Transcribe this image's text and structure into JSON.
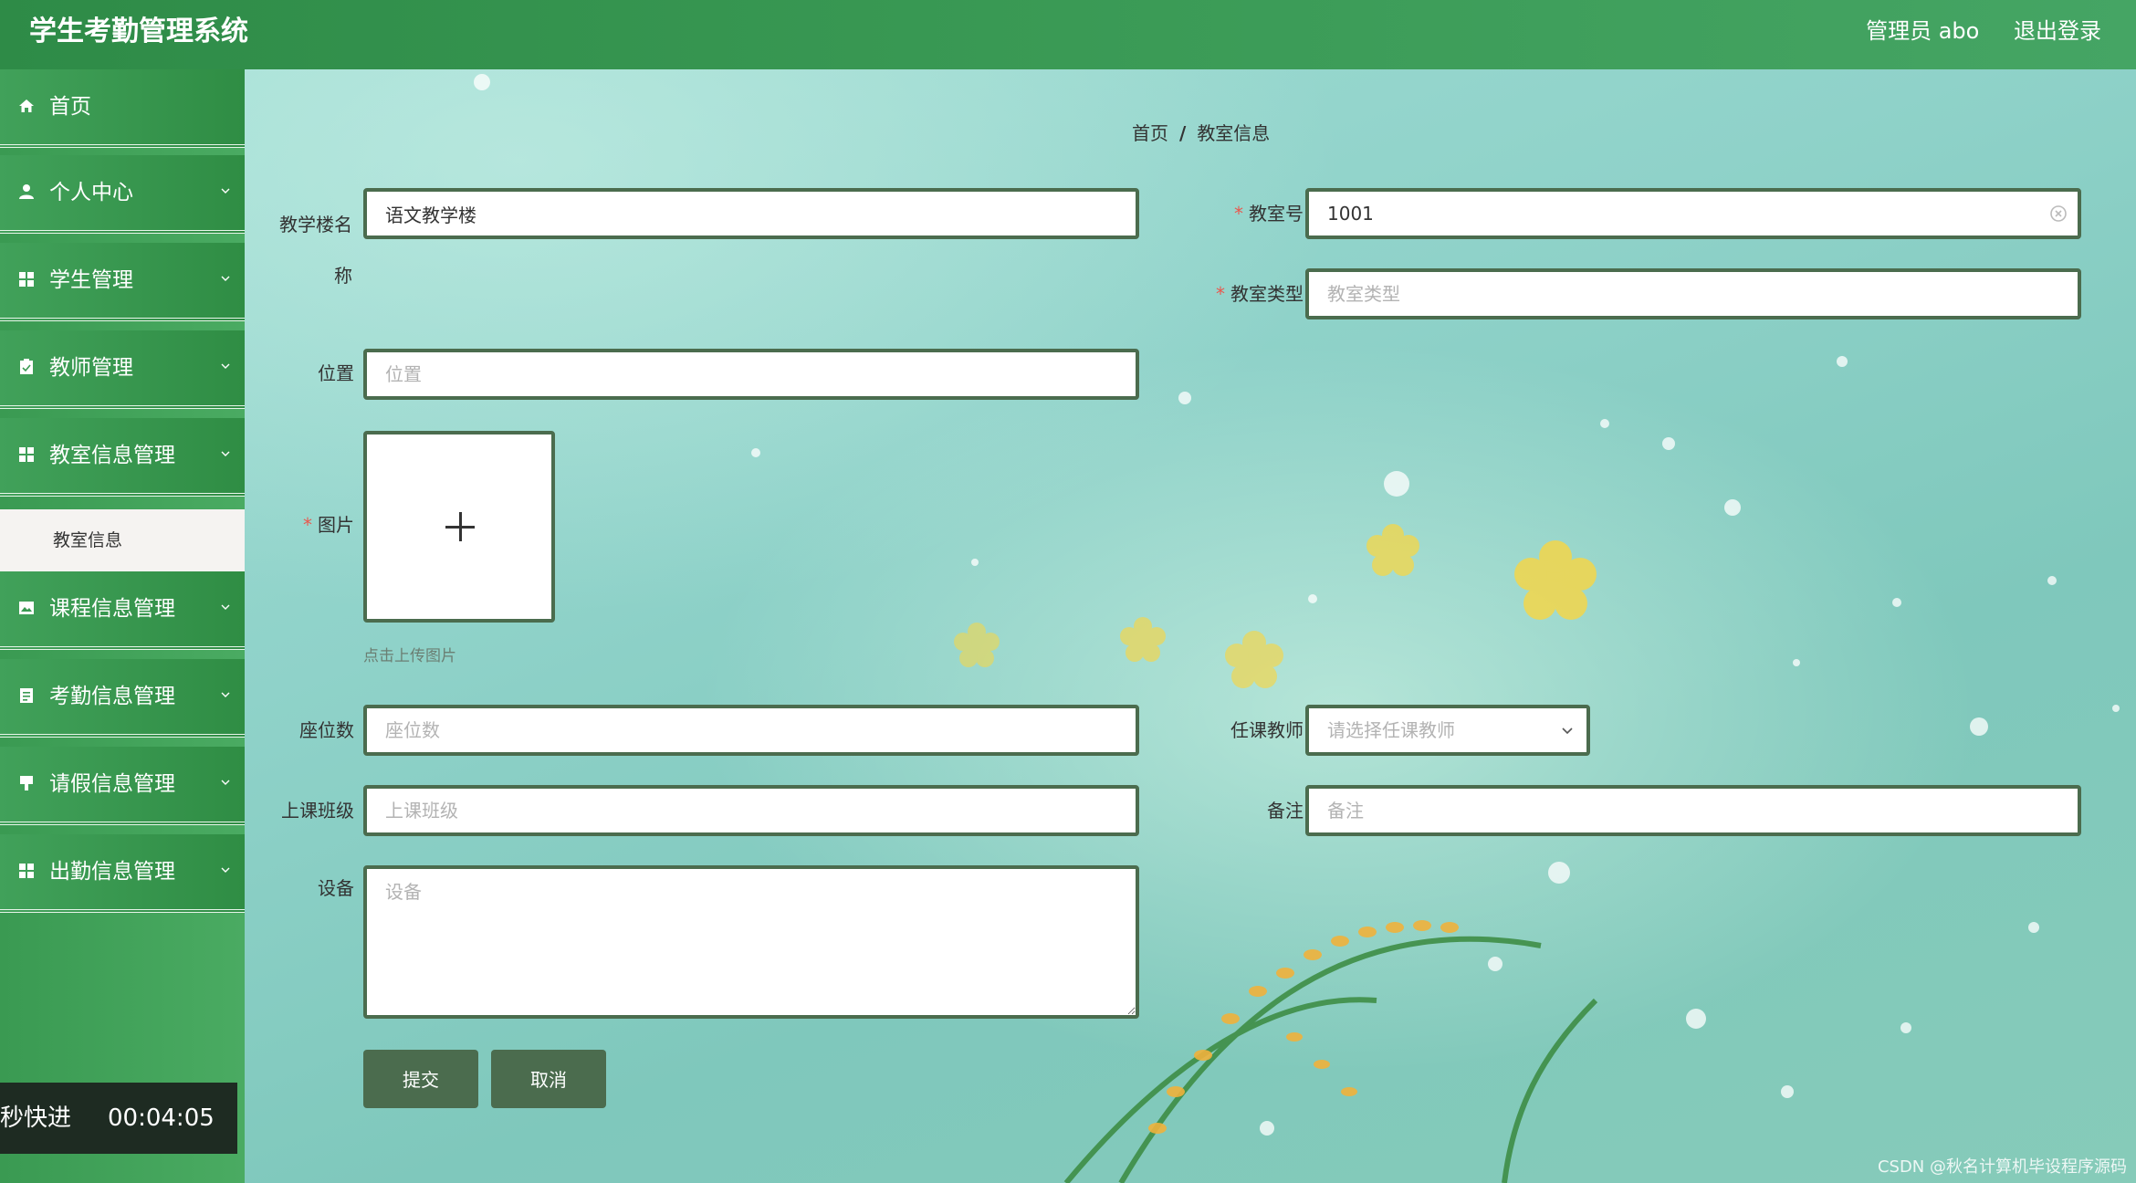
{
  "header": {
    "title": "学生考勤管理系统",
    "user": "管理员 abo",
    "logout": "退出登录"
  },
  "sidebar": {
    "items": [
      {
        "label": "首页",
        "icon": "home-icon"
      },
      {
        "label": "个人中心",
        "icon": "user-icon"
      },
      {
        "label": "学生管理",
        "icon": "grid-icon"
      },
      {
        "label": "教师管理",
        "icon": "clipboard-icon"
      },
      {
        "label": "教室信息管理",
        "icon": "grid-icon"
      },
      {
        "label": "课程信息管理",
        "icon": "image-icon"
      },
      {
        "label": "考勤信息管理",
        "icon": "list-icon"
      },
      {
        "label": "请假信息管理",
        "icon": "bookmark-icon"
      },
      {
        "label": "出勤信息管理",
        "icon": "grid-icon"
      }
    ],
    "submenu": {
      "label": "教室信息"
    }
  },
  "breadcrumb": {
    "home": "首页",
    "sep": "/",
    "current": "教室信息"
  },
  "form": {
    "building": {
      "label": "教学楼名称",
      "value": "语文教学楼"
    },
    "room_no": {
      "label": "教室号",
      "value": "1001"
    },
    "room_type": {
      "label": "教室类型",
      "placeholder": "教室类型"
    },
    "location": {
      "label": "位置",
      "placeholder": "位置"
    },
    "image": {
      "label": "图片",
      "tip": "点击上传图片"
    },
    "seats": {
      "label": "座位数",
      "placeholder": "座位数"
    },
    "teacher": {
      "label": "任课教师",
      "placeholder": "请选择任课教师"
    },
    "class_group": {
      "label": "上课班级",
      "placeholder": "上课班级"
    },
    "remark": {
      "label": "备注",
      "placeholder": "备注"
    },
    "equipment": {
      "label": "设备",
      "placeholder": "设备"
    },
    "submit": "提交",
    "cancel": "取消",
    "required_mark": "*"
  },
  "video_overlay": {
    "speed": "秒快进",
    "time": "00:04:05"
  },
  "watermark": "CSDN @秋名计算机毕设程序源码",
  "colors": {
    "header": "#2e8b47",
    "sidebar": "#3a9a52",
    "button": "#4b6c4e",
    "required": "#e9584e"
  }
}
